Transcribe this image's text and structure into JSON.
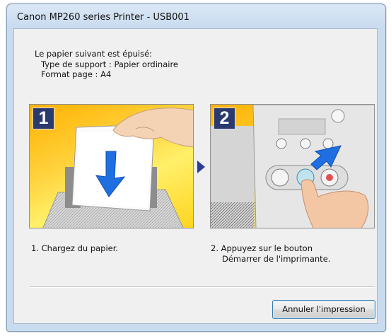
{
  "window": {
    "title": "Canon MP260 series Printer - USB001"
  },
  "message": {
    "line1": "Le papier suivant est épuisé:",
    "line2": "Type de support : Papier ordinaire",
    "line3": "Format page : A4"
  },
  "steps": [
    {
      "number": "1",
      "caption_line1": "1.  Chargez du papier.",
      "caption_line2": ""
    },
    {
      "number": "2",
      "caption_line1": "2.  Appuyez sur le bouton",
      "caption_line2": "Démarrer de l'imprimante."
    }
  ],
  "buttons": {
    "cancel_label": "Annuler l'impression"
  },
  "colors": {
    "accent": "#2a3a6e",
    "panel_orange": "#ffb000",
    "arrow_blue": "#1f6fe0"
  }
}
